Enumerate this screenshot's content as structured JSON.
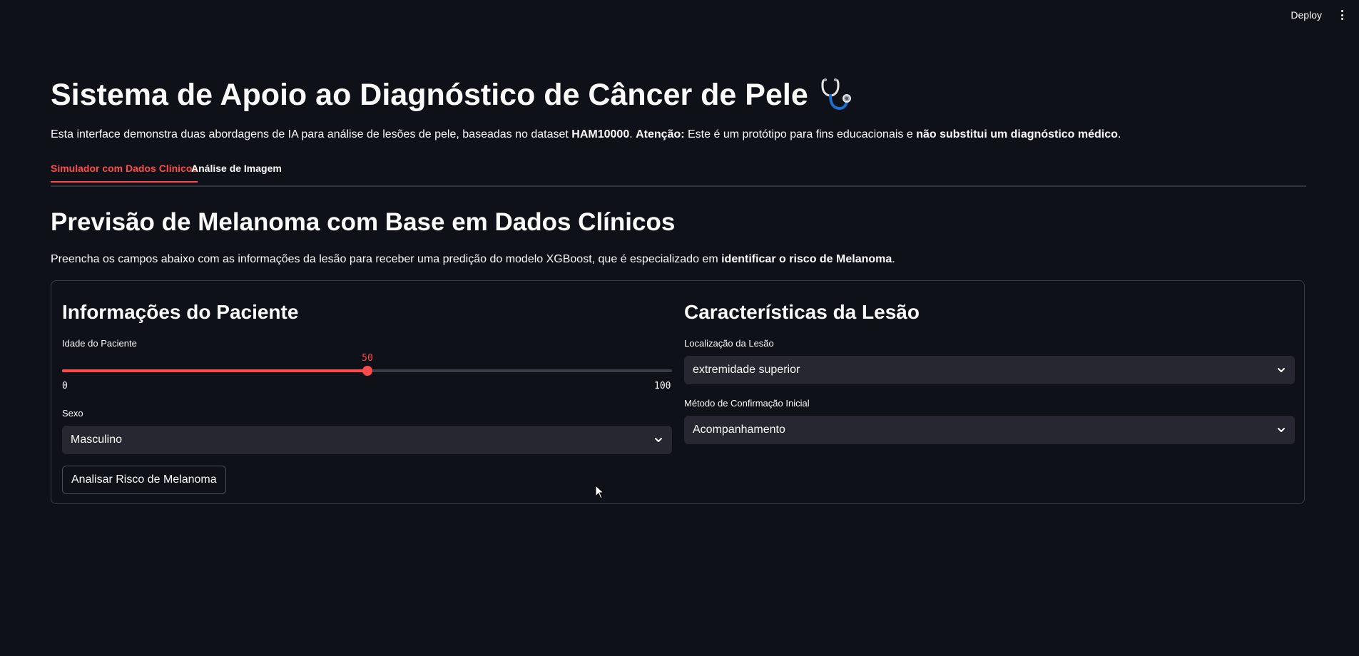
{
  "topbar": {
    "deploy_label": "Deploy",
    "menu_icon": "vertical-dots-icon"
  },
  "header": {
    "title": "Sistema de Apoio ao Diagnóstico de Câncer de Pele",
    "title_icon": "stethoscope-icon",
    "intro_part1": "Esta interface demonstra duas abordagens de IA para análise de lesões de pele, baseadas no dataset ",
    "intro_dataset": "HAM10000",
    "intro_part2": ". ",
    "intro_attention": "Atenção:",
    "intro_part3": " Este é um protótipo para fins educacionais e ",
    "intro_warning": "não substitui um diagnóstico médico",
    "intro_end": "."
  },
  "tabs": [
    {
      "label": "Simulador com Dados Clínicos",
      "active": true
    },
    {
      "label": "Análise de Imagem",
      "active": false
    }
  ],
  "section": {
    "title": "Previsão de Melanoma com Base em Dados Clínicos",
    "desc_part1": "Preencha os campos abaixo com as informações da lesão para receber uma predição do modelo XGBoost, que é especializado em ",
    "desc_bold": "identificar o risco de Melanoma",
    "desc_end": "."
  },
  "patient": {
    "title": "Informações do Paciente",
    "age_label": "Idade do Paciente",
    "age_value": "50",
    "age_min": "0",
    "age_max": "100",
    "age_fraction": 0.5,
    "sex_label": "Sexo",
    "sex_value": "Masculino",
    "analyze_button": "Analisar Risco de Melanoma"
  },
  "lesion": {
    "title": "Características da Lesão",
    "location_label": "Localização da Lesão",
    "location_value": "extremidade superior",
    "method_label": "Método de Confirmação Inicial",
    "method_value": "Acompanhamento"
  },
  "colors": {
    "background": "#0e1117",
    "accent": "#ff4b4b",
    "input_bg": "#262730",
    "text": "#fafafa"
  }
}
